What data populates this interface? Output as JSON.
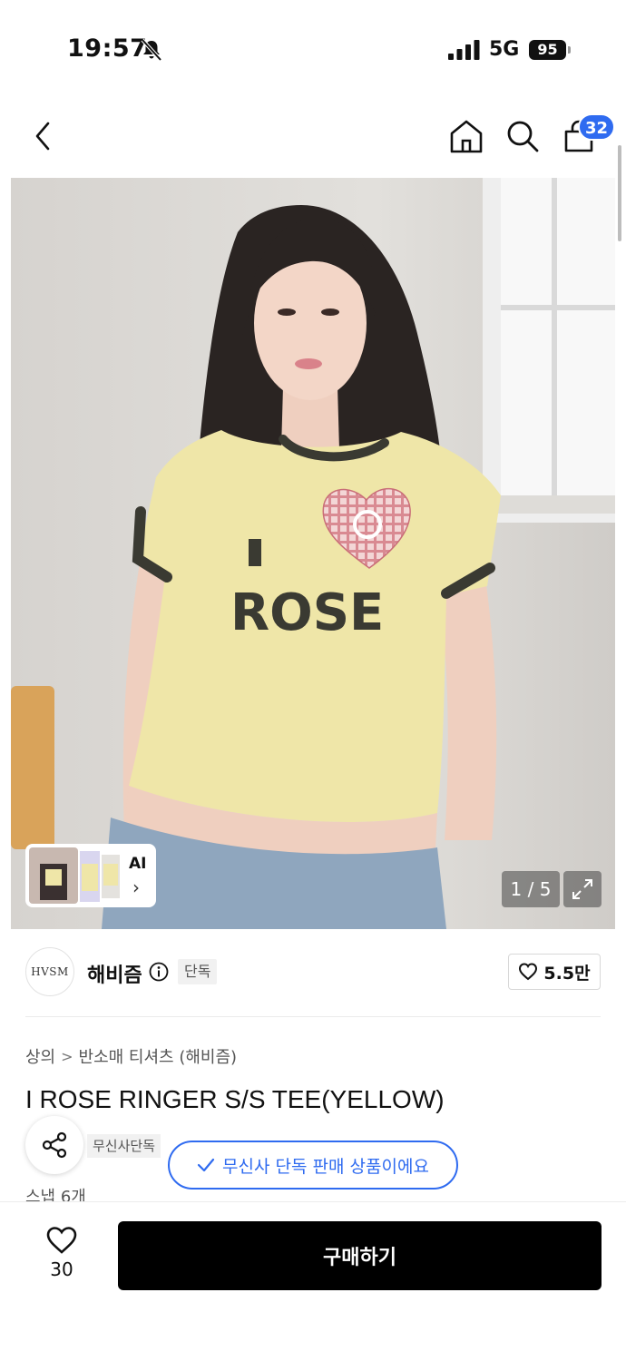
{
  "status_bar": {
    "time": "19:57",
    "network": "5G",
    "battery": "95"
  },
  "nav": {
    "cart_count": "32"
  },
  "gallery": {
    "ai_label": "AI",
    "ai_chevron": "›",
    "counter": "1 / 5",
    "shirt_print_text": "ROSE"
  },
  "brand": {
    "logo_text": "HVSM",
    "name": "해비즘",
    "exclusive_tag": "단독",
    "like_count": "5.5만"
  },
  "breadcrumb": {
    "category": "상의",
    "separator": ">",
    "subcategory": "반소매 티셔츠 (해비즘)"
  },
  "product": {
    "title": "I ROSE RINGER S/S TEE(YELLOW)",
    "musinsa_tag": "무신사단독",
    "exclusive_tooltip": "무신사 단독 판매 상품이에요",
    "snap_count": "스냅 6개"
  },
  "bottom_bar": {
    "wishlist_count": "30",
    "buy_label": "구매하기"
  },
  "icons": {
    "back": "chevron-left-icon",
    "home": "home-icon",
    "search": "search-icon",
    "cart": "shopping-bag-icon",
    "expand": "expand-icon",
    "info": "info-icon",
    "heart": "heart-icon",
    "share": "share-icon",
    "check": "check-icon",
    "bell_muted": "bell-slash-icon",
    "signal": "signal-icon"
  },
  "colors": {
    "accent_blue": "#2f6bf0",
    "buy_button": "#000000",
    "shirt_yellow": "#efe6a8"
  }
}
